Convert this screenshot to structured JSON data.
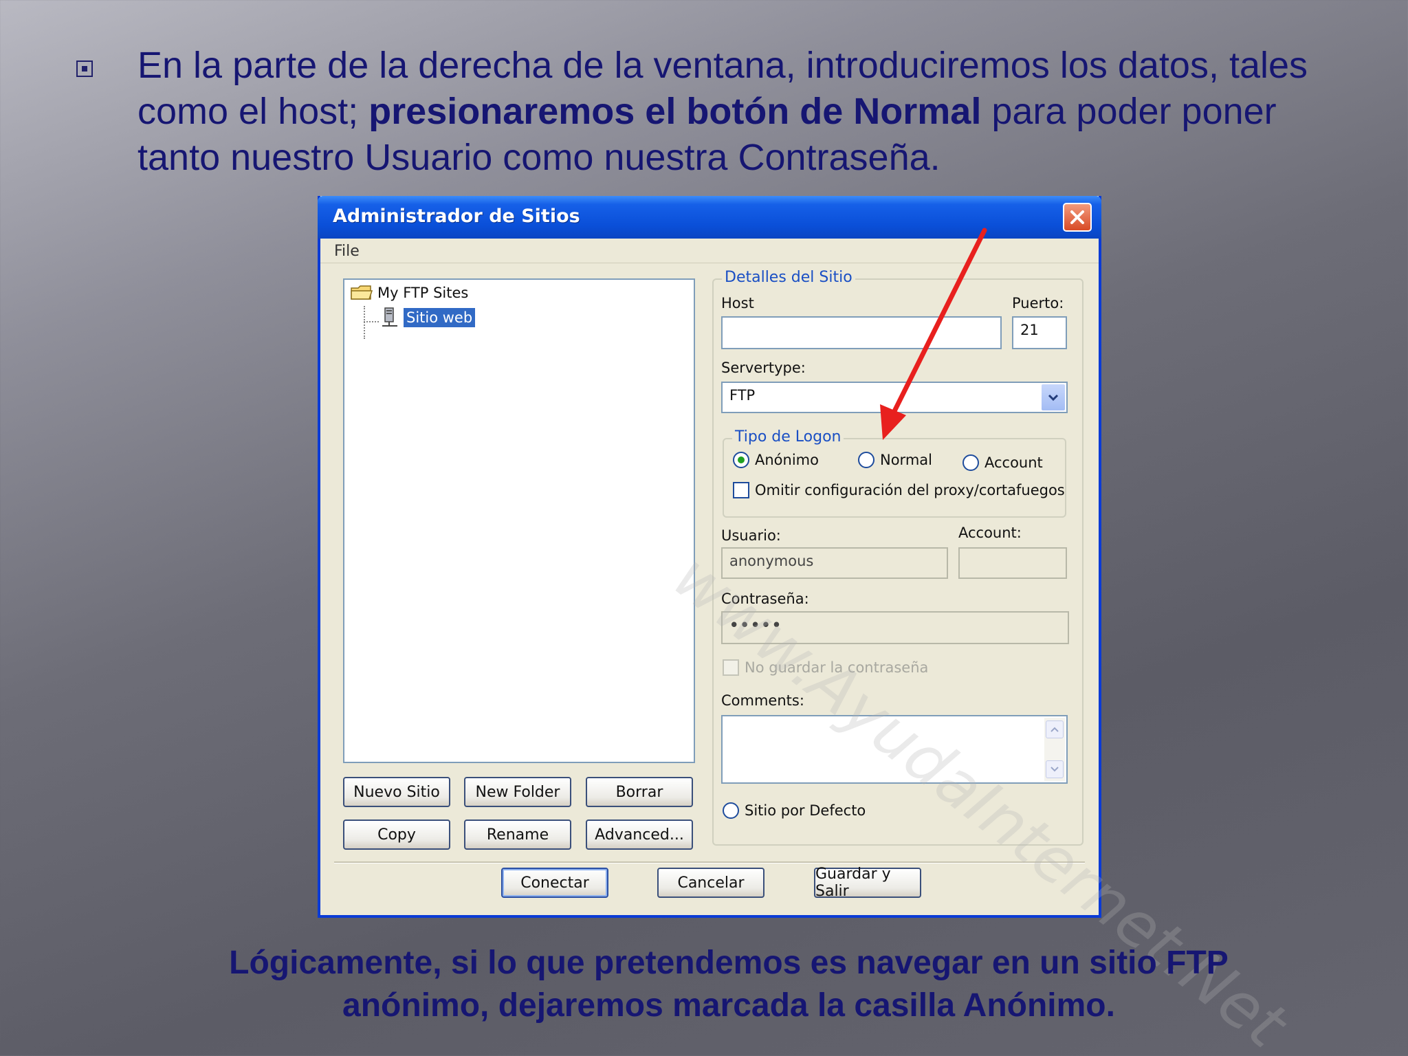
{
  "slide": {
    "bullet_text_part1": "En la parte de la derecha de la ventana, introduciremos los datos, tales como el host; ",
    "bullet_text_bold": "presionaremos el botón de Normal",
    "bullet_text_part2": " para poder poner tanto nuestro Usuario como nuestra Contraseña.",
    "caption_line1": "Lógicamente, si lo que pretendemos es navegar en un sitio FTP",
    "caption_line2": "anónimo, dejaremos marcada la casilla Anónimo."
  },
  "window": {
    "title": "Administrador de Sitios",
    "menu": [
      "File"
    ],
    "watermark": "www.AyudaInternet.Net"
  },
  "tree": {
    "root": "My FTP Sites",
    "child": "Sitio web"
  },
  "left_buttons": [
    "Nuevo Sitio",
    "New Folder",
    "Borrar",
    "Copy",
    "Rename",
    "Advanced..."
  ],
  "details": {
    "group_title": "Detalles del Sitio",
    "host_label": "Host",
    "host_value": "",
    "port_label": "Puerto:",
    "port_value": "21",
    "servertype_label": "Servertype:",
    "servertype_value": "FTP",
    "logon_group_title": "Tipo de Logon",
    "logon_options": [
      "Anónimo",
      "Normal",
      "Account"
    ],
    "logon_selected": "Anónimo",
    "bypass_proxy_label": "Omitir configuración del proxy/cortafuegos",
    "user_label": "Usuario:",
    "user_value": "anonymous",
    "account_label": "Account:",
    "account_value": "",
    "password_label": "Contraseña:",
    "password_value": "•••••",
    "no_save_password_label": "No guardar la contraseña",
    "comments_label": "Comments:",
    "default_site_label": "Sitio por Defecto"
  },
  "bottom_buttons": [
    "Conectar",
    "Cancelar",
    "Guardar y Salir"
  ],
  "colors": {
    "slide_text": "#161672",
    "titlebar": "#0a4fd8",
    "group_title": "#1a4fc4",
    "arrow": "#e8201e"
  }
}
